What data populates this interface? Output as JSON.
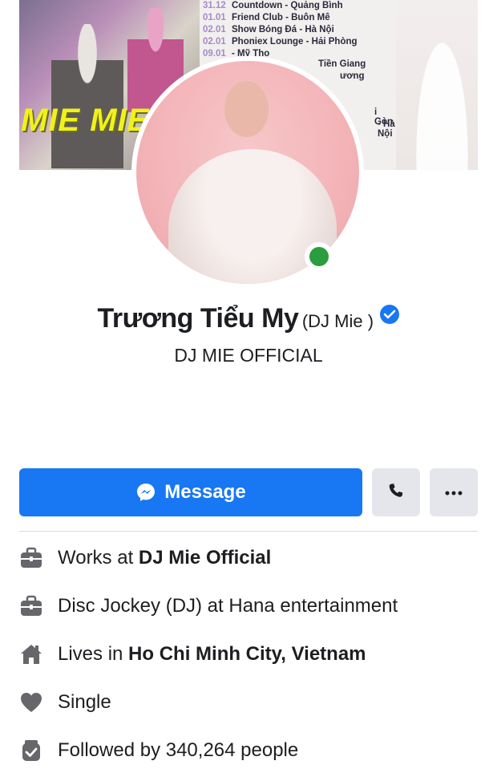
{
  "cover": {
    "mie_text": "MIE MIE",
    "schedule": [
      {
        "date": "31.12",
        "event": "Countdown - Quảng Bình"
      },
      {
        "date": "01.01",
        "event": "Friend Club - Buôn Mê"
      },
      {
        "date": "02.01",
        "event": "Show Bóng Đá - Hà Nội"
      },
      {
        "date": "02.01",
        "event": "Phoniex Lounge - Hải Phòng"
      },
      {
        "date": "09.01",
        "event": "- Mỹ Tho"
      }
    ],
    "partial_text": [
      "Tiền Giang",
      "ương",
      "i Gòn",
      "- Hà Nội"
    ]
  },
  "profile": {
    "name": "Trương Tiểu My",
    "alt_name": "(DJ Mie )",
    "subtitle": "DJ MIE OFFICIAL"
  },
  "actions": {
    "message_label": "Message"
  },
  "info": [
    {
      "icon": "briefcase-icon",
      "prefix": "Works at ",
      "bold": "DJ Mie Official",
      "suffix": ""
    },
    {
      "icon": "briefcase-icon",
      "prefix": "Disc Jockey (DJ) at Hana entertainment",
      "bold": "",
      "suffix": ""
    },
    {
      "icon": "home-icon",
      "prefix": "Lives in ",
      "bold": "Ho Chi Minh City, Vietnam",
      "suffix": ""
    },
    {
      "icon": "heart-icon",
      "prefix": "Single",
      "bold": "",
      "suffix": ""
    },
    {
      "icon": "followers-icon",
      "prefix": "Followed by 340,264 people",
      "bold": "",
      "suffix": ""
    }
  ],
  "colors": {
    "accent": "#1877f2",
    "online": "#2a9d3e",
    "button_gray": "#e4e6eb"
  }
}
